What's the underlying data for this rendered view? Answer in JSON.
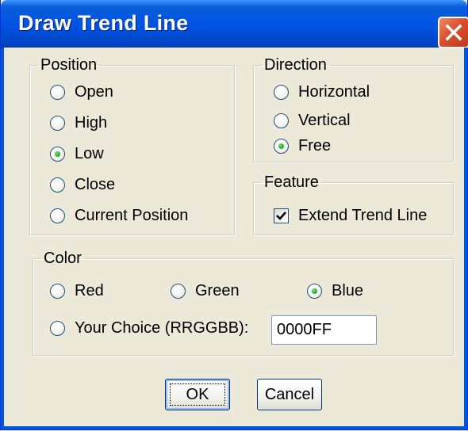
{
  "dialog": {
    "title": "Draw Trend Line",
    "close_icon": "close-icon",
    "titlebar_color": "#0054e3",
    "close_color": "#d9502f"
  },
  "position": {
    "legend": "Position",
    "options": [
      "Open",
      "High",
      "Low",
      "Close",
      "Current Position"
    ],
    "selected": "Low"
  },
  "direction": {
    "legend": "Direction",
    "options": [
      "Horizontal",
      "Vertical",
      "Free"
    ],
    "selected": "Free"
  },
  "feature": {
    "legend": "Feature",
    "checkbox_label": "Extend Trend Line",
    "checked": true
  },
  "color": {
    "legend": "Color",
    "options": [
      "Red",
      "Green",
      "Blue"
    ],
    "custom_label": "Your Choice (RRGGBB):",
    "selected": "Blue",
    "custom_value": "0000FF"
  },
  "buttons": {
    "ok": "OK",
    "cancel": "Cancel"
  }
}
